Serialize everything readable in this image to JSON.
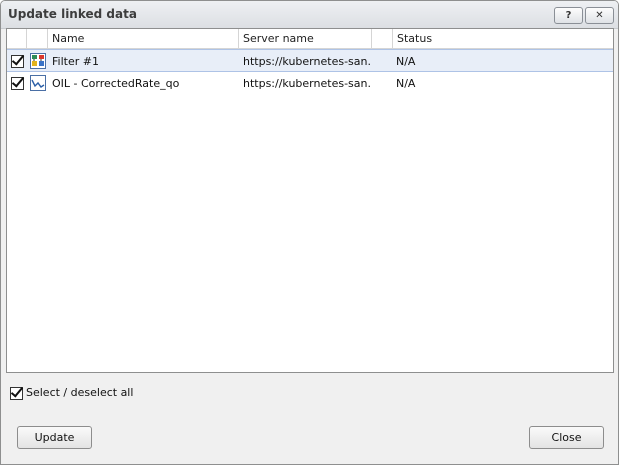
{
  "window": {
    "title": "Update linked data",
    "help_label": "?",
    "close_label": "✕"
  },
  "table": {
    "columns": {
      "name": "Name",
      "server": "Server name",
      "status": "Status"
    },
    "rows": [
      {
        "checked": true,
        "icon": "filter-icon",
        "name": "Filter #1",
        "server": "https://kubernetes-san...",
        "status": "N/A",
        "selected": true
      },
      {
        "checked": true,
        "icon": "line-chart-icon",
        "name": "OIL - CorrectedRate_qo",
        "server": "https://kubernetes-san...",
        "status": "N/A",
        "selected": false
      }
    ]
  },
  "footer": {
    "select_all_label": "Select / deselect all",
    "select_all_checked": true,
    "update_label": "Update",
    "close_label": "Close"
  }
}
